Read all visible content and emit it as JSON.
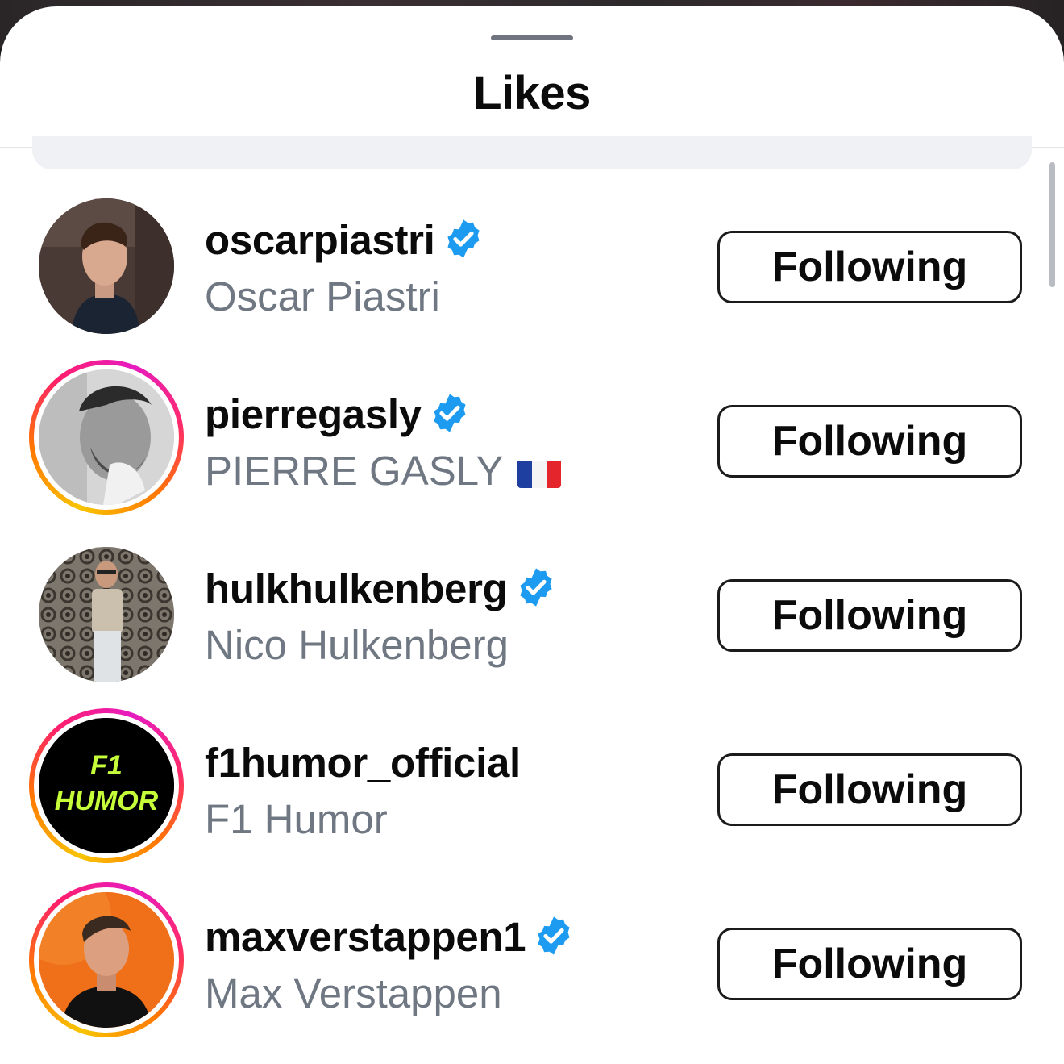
{
  "sheet": {
    "title": "Likes"
  },
  "users": [
    {
      "username": "oscarpiastri",
      "full_name": "Oscar Piastri",
      "verified": true,
      "story_ring": false,
      "action_label": "Following",
      "avatar": "photo-oscarpiastri"
    },
    {
      "username": "pierregasly",
      "full_name": "PIERRE GASLY",
      "flag": "france-flag",
      "verified": true,
      "story_ring": true,
      "action_label": "Following",
      "avatar": "photo-pierregasly"
    },
    {
      "username": "hulkhulkenberg",
      "full_name": "Nico Hulkenberg",
      "verified": true,
      "story_ring": false,
      "action_label": "Following",
      "avatar": "photo-hulkhulkenberg"
    },
    {
      "username": "f1humor_official",
      "full_name": "F1 Humor",
      "verified": false,
      "story_ring": true,
      "action_label": "Following",
      "avatar": "logo-f1humor",
      "avatar_text": [
        "F1",
        "HUMOR"
      ]
    },
    {
      "username": "maxverstappen1",
      "full_name": "Max Verstappen",
      "verified": true,
      "story_ring": true,
      "action_label": "Following",
      "avatar": "photo-maxverstappen1"
    }
  ],
  "colors": {
    "verified_blue": "#1d9bf0",
    "secondary_text": "#6f7782",
    "button_border": "#1b1b1b"
  }
}
